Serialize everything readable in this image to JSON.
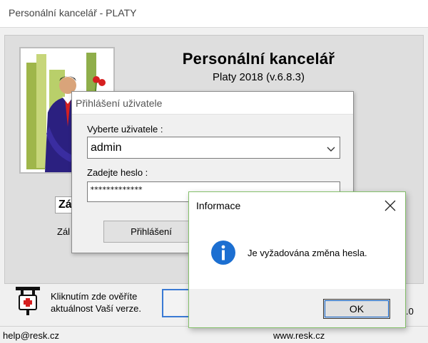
{
  "main_window": {
    "title": "Personální kancelář - PLATY",
    "app_title": "Personální kancelář",
    "app_version": "Platy 2018 (v.6.8.3)",
    "background_field_fragment": "Zá",
    "background_label_fragment": "Zál",
    "update_check": {
      "text_line1": "Kliknutím zde ověříte",
      "text_line2": "aktuálnost Vaší verze."
    },
    "version_fragment": ".0"
  },
  "status_bar": {
    "email": "help@resk.cz",
    "website": "www.resk.cz"
  },
  "login_dialog": {
    "title": "Přihlášení uživatele",
    "user_label": "Vyberte uživatele :",
    "user_value": "admin",
    "password_label": "Zadejte heslo :",
    "password_mask": "*************",
    "login_button": "Přihlášení"
  },
  "info_dialog": {
    "title": "Informace",
    "message": "Je vyžadována změna hesla.",
    "ok_button": "OK"
  },
  "icons": {
    "close": "close-icon",
    "info": "info-icon",
    "chevron": "chevron-down-icon",
    "update": "update-plug-icon"
  },
  "colors": {
    "dialog_accent": "#84c06a",
    "info_icon": "#1c6fd1",
    "focus": "#0b5fc7"
  }
}
